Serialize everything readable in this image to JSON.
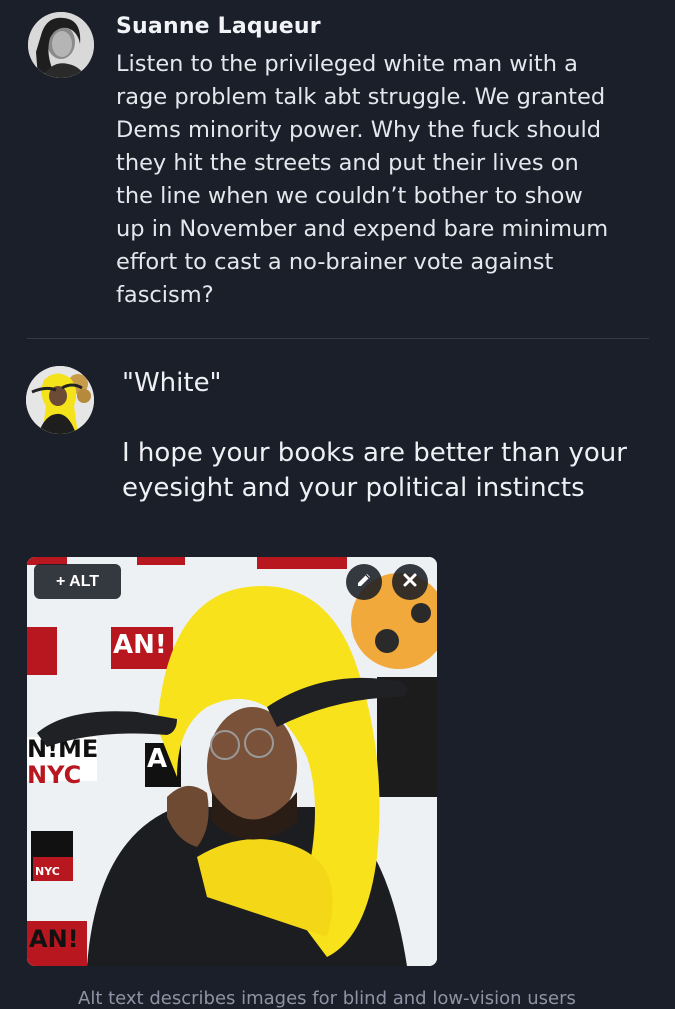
{
  "post1": {
    "author": "Suanne Laqueur",
    "text": "Listen to the privileged white man with a\nrage problem talk abt struggle. We granted\nDems minority power. Why the fuck should\nthey hit the streets and put their lives on\nthe line when we couldn’t bother to show\nup in November and expend bare minimum\neffort to cast a no-brainer vote against\nfascism?"
  },
  "reply": {
    "text": "\"White\"\n\nI hope your books are better than your\neyesight and your political instincts"
  },
  "media": {
    "alt_button_label": "+ ALT",
    "edit_icon": "pencil-icon",
    "remove_icon": "close-icon"
  },
  "footer": {
    "text": "Alt text describes images for blind and low-vision users"
  },
  "colors": {
    "background": "#1a1f2a",
    "text": "#e4e7ec",
    "divider": "#333947"
  }
}
